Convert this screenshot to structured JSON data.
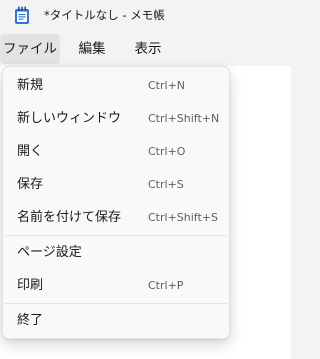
{
  "window": {
    "title": "*タイトルなし - メモ帳"
  },
  "menubar": {
    "items": [
      {
        "label": "ファイル"
      },
      {
        "label": "編集"
      },
      {
        "label": "表示"
      }
    ],
    "active": "ファイル"
  },
  "file_menu": {
    "items": [
      {
        "label": "新規",
        "shortcut": "Ctrl+N"
      },
      {
        "label": "新しいウィンドウ",
        "shortcut": "Ctrl+Shift+N"
      },
      {
        "label": "開く",
        "shortcut": "Ctrl+O"
      },
      {
        "label": "保存",
        "shortcut": "Ctrl+S"
      },
      {
        "label": "名前を付けて保存",
        "shortcut": "Ctrl+Shift+S"
      },
      {
        "label": "ページ設定",
        "shortcut": ""
      },
      {
        "label": "印刷",
        "shortcut": "Ctrl+P"
      },
      {
        "label": "終了",
        "shortcut": ""
      }
    ]
  },
  "colors": {
    "icon_blue": "#2b6fd6",
    "active_menu_bg": "#e3e3e3"
  },
  "icons": {
    "app": "notepad-icon"
  }
}
